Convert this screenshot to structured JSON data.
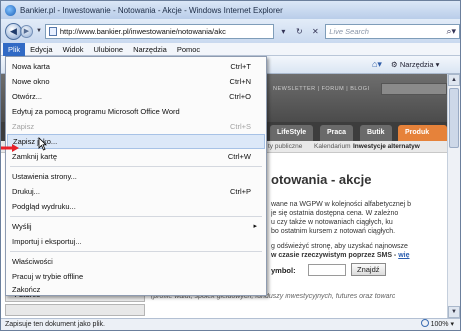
{
  "window": {
    "title": "Bankier.pl - Inwestowanie - Notowania - Akcje - Windows Internet Explorer"
  },
  "address_bar": {
    "url": "http://www.bankier.pl/inwestowanie/notowania/akc",
    "search_placeholder": "Live Search"
  },
  "menubar": {
    "items": [
      "Plik",
      "Edycja",
      "Widok",
      "Ulubione",
      "Narzędzia",
      "Pomoc"
    ],
    "active_index": 0
  },
  "toolbar": {
    "page_label": "Narzędzia"
  },
  "file_menu": {
    "items": [
      {
        "label": "Nowa karta",
        "shortcut": "Ctrl+T",
        "disabled": false
      },
      {
        "label": "Nowe okno",
        "shortcut": "Ctrl+N",
        "disabled": false
      },
      {
        "label": "Otwórz...",
        "shortcut": "Ctrl+O",
        "disabled": false
      },
      {
        "label": "Edytuj za pomocą programu Microsoft Office Word",
        "shortcut": "",
        "disabled": false
      },
      {
        "label": "Zapisz",
        "shortcut": "Ctrl+S",
        "disabled": true
      },
      {
        "label": "Zapisz jako...",
        "shortcut": "",
        "disabled": false,
        "highlighted": true
      },
      {
        "label": "Zamknij kartę",
        "shortcut": "Ctrl+W",
        "disabled": false
      },
      {
        "label": "Ustawienia strony...",
        "shortcut": "",
        "disabled": false
      },
      {
        "label": "Drukuj...",
        "shortcut": "Ctrl+P",
        "disabled": false
      },
      {
        "label": "Podgląd wydruku...",
        "shortcut": "",
        "disabled": false
      },
      {
        "label": "Wyślij",
        "shortcut": "",
        "disabled": false,
        "submenu": true
      },
      {
        "label": "Importuj i eksportuj...",
        "shortcut": "",
        "disabled": false
      },
      {
        "label": "Właściwości",
        "shortcut": "",
        "disabled": false
      },
      {
        "label": "Pracuj w trybie offline",
        "shortcut": "",
        "disabled": false
      },
      {
        "label": "Zakończ",
        "shortcut": "",
        "disabled": false
      }
    ]
  },
  "site": {
    "toplinks": "NEWSLETTER | FORUM | BLOGI",
    "nav_tabs": [
      "LifeStyle",
      "Praca",
      "Butik",
      "Produk"
    ],
    "subnav": [
      "ty publiczne",
      "Kalendarium",
      "Inwestycje alternatyw"
    ],
    "heading": "otowania - akcje",
    "body_lines": [
      "wane na WGPW w kolejności alfabetycznej b",
      "je się ostatnia dostępna cena. W zależno",
      "u czy także w notowaniach ciągłych, ku",
      "bo ostatnim kursem z notowań ciągłych."
    ],
    "body2_line1": "g odświeżyć stronę, aby uzyskać najnowsze",
    "body2_line2_bold": "w czasie rzeczywistym poprzez SMS - ",
    "body2_line2_link": "wię",
    "symbol_label": "ymbol:",
    "find_button": "Znajdź",
    "futures_label": "Futures",
    "futures_desc": "(profile walut, spółek giełdowych, funduszy inwestycyjnych, futures oraz towarc"
  },
  "statusbar": {
    "text": "Zapisuje ten dokument jako plik.",
    "zoom": "100%"
  },
  "colors": {
    "menu_active": "#316ac5",
    "highlight_item": "#dce8f8",
    "accent_tab": "#e6823a",
    "pointer_arrow": "#e8202a"
  }
}
